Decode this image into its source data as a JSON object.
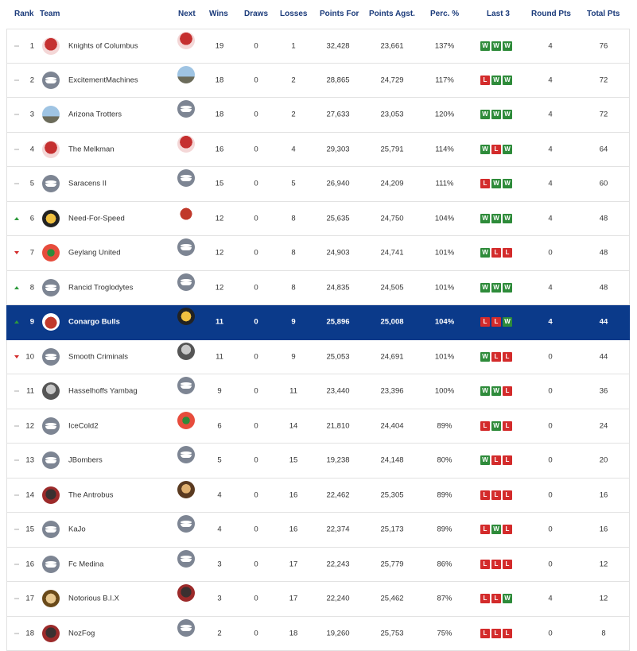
{
  "headers": {
    "rank": "Rank",
    "team": "Team",
    "next": "Next",
    "wins": "Wins",
    "draws": "Draws",
    "losses": "Losses",
    "points_for": "Points For",
    "points_agst": "Points Agst.",
    "perc": "Perc. %",
    "last3": "Last 3",
    "round_pts": "Round Pts",
    "total_pts": "Total Pts"
  },
  "highlight_color": "#0b3a8a",
  "win_color": "#2e8b3a",
  "loss_color": "#d32b2b",
  "rows": [
    {
      "rank": "1",
      "trend": "none",
      "team": "Knights of Columbus",
      "avatar": "av-red",
      "next": "av-red",
      "wins": "19",
      "draws": "0",
      "losses": "1",
      "pf": "32,428",
      "pa": "23,661",
      "pc": "137%",
      "last3": [
        "W",
        "W",
        "W"
      ],
      "rp": "4",
      "tp": "76"
    },
    {
      "rank": "2",
      "trend": "none",
      "team": "ExcitementMachines",
      "avatar": "puck",
      "next": "av-sky",
      "wins": "18",
      "draws": "0",
      "losses": "2",
      "pf": "28,865",
      "pa": "24,729",
      "pc": "117%",
      "last3": [
        "L",
        "W",
        "W"
      ],
      "rp": "4",
      "tp": "72"
    },
    {
      "rank": "3",
      "trend": "none",
      "team": "Arizona Trotters",
      "avatar": "av-sky",
      "next": "puck",
      "wins": "18",
      "draws": "0",
      "losses": "2",
      "pf": "27,633",
      "pa": "23,053",
      "pc": "120%",
      "last3": [
        "W",
        "W",
        "W"
      ],
      "rp": "4",
      "tp": "72"
    },
    {
      "rank": "4",
      "trend": "none",
      "team": "The Melkman",
      "avatar": "av-red",
      "next": "av-red",
      "wins": "16",
      "draws": "0",
      "losses": "4",
      "pf": "29,303",
      "pa": "25,791",
      "pc": "114%",
      "last3": [
        "W",
        "L",
        "W"
      ],
      "rp": "4",
      "tp": "64"
    },
    {
      "rank": "5",
      "trend": "none",
      "team": "Saracens II",
      "avatar": "puck",
      "next": "puck",
      "wins": "15",
      "draws": "0",
      "losses": "5",
      "pf": "26,940",
      "pa": "24,209",
      "pc": "111%",
      "last3": [
        "L",
        "W",
        "W"
      ],
      "rp": "4",
      "tp": "60"
    },
    {
      "rank": "6",
      "trend": "up",
      "team": "Need-For-Speed",
      "avatar": "av-tiger",
      "next": "av-bull",
      "wins": "12",
      "draws": "0",
      "losses": "8",
      "pf": "25,635",
      "pa": "24,750",
      "pc": "104%",
      "last3": [
        "W",
        "W",
        "W"
      ],
      "rp": "4",
      "tp": "48"
    },
    {
      "rank": "7",
      "trend": "down",
      "team": "Geylang United",
      "avatar": "av-water",
      "next": "puck",
      "wins": "12",
      "draws": "0",
      "losses": "8",
      "pf": "24,903",
      "pa": "24,741",
      "pc": "101%",
      "last3": [
        "W",
        "L",
        "L"
      ],
      "rp": "0",
      "tp": "48"
    },
    {
      "rank": "8",
      "trend": "up",
      "team": "Rancid Troglodytes",
      "avatar": "puck",
      "next": "puck",
      "wins": "12",
      "draws": "0",
      "losses": "8",
      "pf": "24,835",
      "pa": "24,505",
      "pc": "101%",
      "last3": [
        "W",
        "W",
        "W"
      ],
      "rp": "4",
      "tp": "48"
    },
    {
      "rank": "9",
      "trend": "up",
      "team": "Conargo Bulls",
      "avatar": "av-bull",
      "next": "av-tiger",
      "wins": "11",
      "draws": "0",
      "losses": "9",
      "pf": "25,896",
      "pa": "25,008",
      "pc": "104%",
      "last3": [
        "L",
        "L",
        "W"
      ],
      "rp": "4",
      "tp": "44",
      "highlight": true
    },
    {
      "rank": "10",
      "trend": "down",
      "team": "Smooth Criminals",
      "avatar": "puck",
      "next": "av-photo",
      "wins": "11",
      "draws": "0",
      "losses": "9",
      "pf": "25,053",
      "pa": "24,691",
      "pc": "101%",
      "last3": [
        "W",
        "L",
        "L"
      ],
      "rp": "0",
      "tp": "44"
    },
    {
      "rank": "11",
      "trend": "none",
      "team": "Hasselhoffs Yambag",
      "avatar": "av-photo",
      "next": "puck",
      "wins": "9",
      "draws": "0",
      "losses": "11",
      "pf": "23,440",
      "pa": "23,396",
      "pc": "100%",
      "last3": [
        "W",
        "W",
        "L"
      ],
      "rp": "0",
      "tp": "36"
    },
    {
      "rank": "12",
      "trend": "none",
      "team": "IceCold2",
      "avatar": "puck",
      "next": "av-water",
      "wins": "6",
      "draws": "0",
      "losses": "14",
      "pf": "21,810",
      "pa": "24,404",
      "pc": "89%",
      "last3": [
        "L",
        "W",
        "L"
      ],
      "rp": "0",
      "tp": "24"
    },
    {
      "rank": "13",
      "trend": "none",
      "team": "JBombers",
      "avatar": "puck",
      "next": "puck",
      "wins": "5",
      "draws": "0",
      "losses": "15",
      "pf": "19,238",
      "pa": "24,148",
      "pc": "80%",
      "last3": [
        "W",
        "L",
        "L"
      ],
      "rp": "0",
      "tp": "20"
    },
    {
      "rank": "14",
      "trend": "none",
      "team": "The Antrobus",
      "avatar": "av-dark",
      "next": "av-face",
      "wins": "4",
      "draws": "0",
      "losses": "16",
      "pf": "22,462",
      "pa": "25,305",
      "pc": "89%",
      "last3": [
        "L",
        "L",
        "L"
      ],
      "rp": "0",
      "tp": "16"
    },
    {
      "rank": "15",
      "trend": "none",
      "team": "KaJo",
      "avatar": "puck",
      "next": "puck",
      "wins": "4",
      "draws": "0",
      "losses": "16",
      "pf": "22,374",
      "pa": "25,173",
      "pc": "89%",
      "last3": [
        "L",
        "W",
        "L"
      ],
      "rp": "0",
      "tp": "16"
    },
    {
      "rank": "16",
      "trend": "none",
      "team": "Fc Medina",
      "avatar": "puck",
      "next": "puck",
      "wins": "3",
      "draws": "0",
      "losses": "17",
      "pf": "22,243",
      "pa": "25,779",
      "pc": "86%",
      "last3": [
        "L",
        "L",
        "L"
      ],
      "rp": "0",
      "tp": "12"
    },
    {
      "rank": "17",
      "trend": "none",
      "team": "Notorious B.I.X",
      "avatar": "av-gold",
      "next": "av-dark",
      "wins": "3",
      "draws": "0",
      "losses": "17",
      "pf": "22,240",
      "pa": "25,462",
      "pc": "87%",
      "last3": [
        "L",
        "L",
        "W"
      ],
      "rp": "4",
      "tp": "12"
    },
    {
      "rank": "18",
      "trend": "none",
      "team": "NozFog",
      "avatar": "av-dark",
      "next": "puck",
      "wins": "2",
      "draws": "0",
      "losses": "18",
      "pf": "19,260",
      "pa": "25,753",
      "pc": "75%",
      "last3": [
        "L",
        "L",
        "L"
      ],
      "rp": "0",
      "tp": "8"
    }
  ]
}
